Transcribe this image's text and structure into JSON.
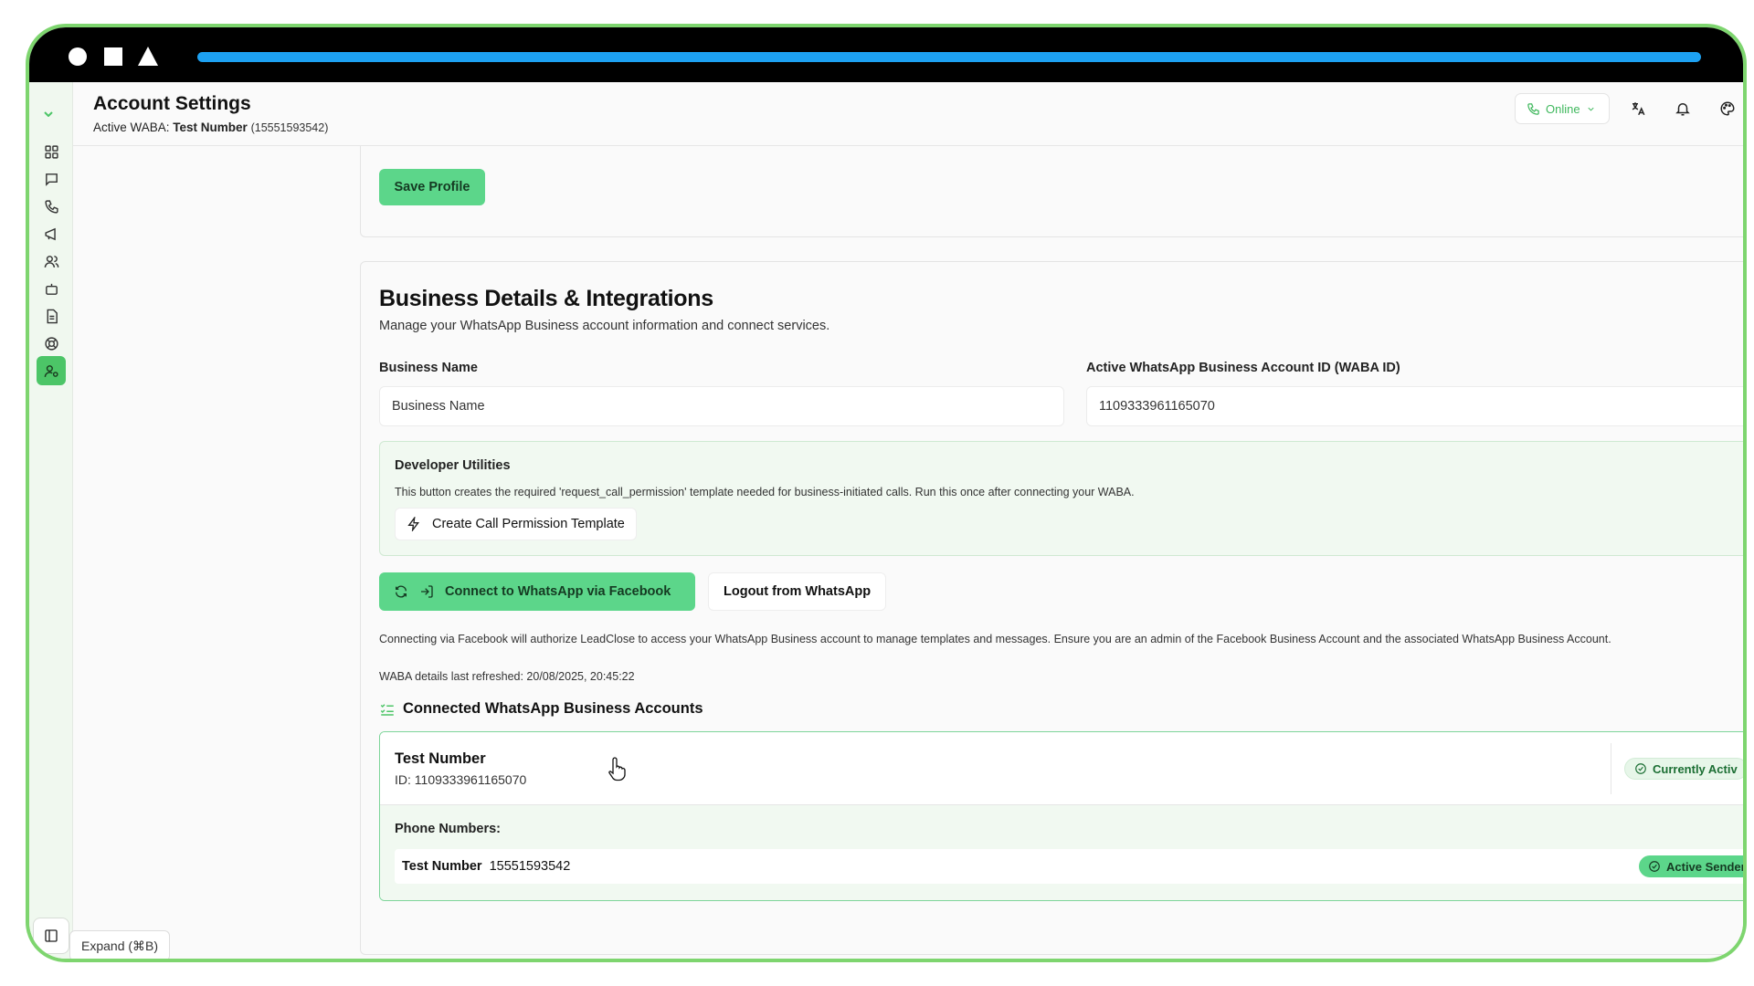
{
  "header": {
    "title": "Account Settings",
    "subtitle_prefix": "Active WABA:",
    "subtitle_name": "Test Number",
    "subtitle_number": "(15551593542)",
    "status": "Online"
  },
  "profile": {
    "save_label": "Save Profile"
  },
  "business": {
    "title": "Business Details & Integrations",
    "subtitle": "Manage your WhatsApp Business account information and connect services.",
    "name_label": "Business Name",
    "name_placeholder": "Business Name",
    "waba_label": "Active WhatsApp Business Account ID (WABA ID)",
    "waba_value": "1109333961165070"
  },
  "developer": {
    "title": "Developer Utilities",
    "description": "This button creates the required 'request_call_permission' template needed for business-initiated calls. Run this once after connecting your WABA.",
    "button_label": "Create Call Permission Template"
  },
  "connect": {
    "connect_label": "Connect to WhatsApp via Facebook",
    "logout_label": "Logout from WhatsApp",
    "note": "Connecting via Facebook will authorize LeadClose to access your WhatsApp Business account to manage templates and messages. Ensure you are an admin of the Facebook Business Account and the associated WhatsApp Business Account.",
    "refreshed": "WABA details last refreshed: 20/08/2025, 20:45:22"
  },
  "accounts": {
    "title": "Connected WhatsApp Business Accounts",
    "items": [
      {
        "name": "Test Number",
        "id": "ID: 1109333961165070",
        "badge": "Currently Activ",
        "phones_label": "Phone Numbers:",
        "phones": [
          {
            "name": "Test Number",
            "number": "15551593542",
            "badge": "Active Sender"
          }
        ]
      }
    ]
  },
  "sidebar": {
    "expand_tip": "Expand (⌘B)"
  },
  "colors": {
    "accent": "#5cd68a",
    "frame": "#7ed56f",
    "progress": "#1da1f2",
    "status": "#3fb85d"
  }
}
